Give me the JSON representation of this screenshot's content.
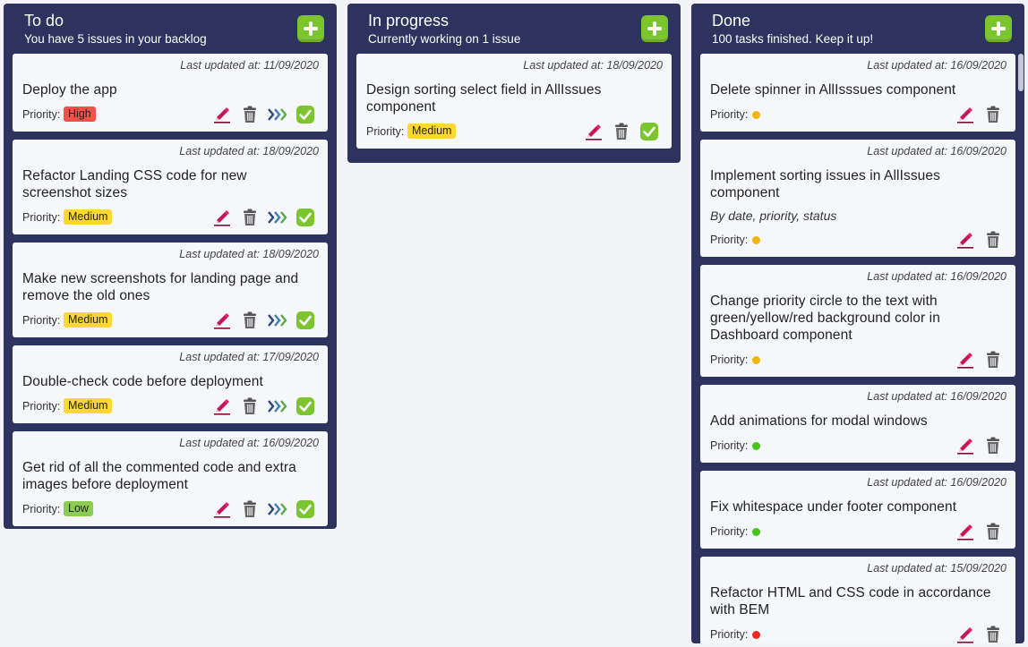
{
  "colors": {
    "column_bg": "#2b335e",
    "card_bg": "#f6f7fa",
    "add_button": "#7dc52e",
    "priority_high": "#ef5247",
    "priority_medium": "#fdd835",
    "priority_low": "#8ccc55",
    "dot_green": "#45c41a",
    "dot_yellow": "#f2b50f",
    "dot_red": "#f2271f"
  },
  "updated_prefix": "Last updated at: ",
  "priority_label": "Priority:",
  "columns": [
    {
      "title": "To do",
      "subtitle": "You have 5 issues in your backlog",
      "cards": [
        {
          "updated": "Last updated at: 11/09/2020",
          "title": "Deploy the app",
          "priority": "High"
        },
        {
          "updated": "Last updated at: 18/09/2020",
          "title": "Refactor Landing CSS code for new screenshot sizes",
          "priority": "Medium"
        },
        {
          "updated": "Last updated at: 18/09/2020",
          "title": "Make new screenshots for landing page and remove the old ones",
          "priority": "Medium"
        },
        {
          "updated": "Last updated at: 17/09/2020",
          "title": "Double-check code before deployment",
          "priority": "Medium"
        },
        {
          "updated": "Last updated at: 16/09/2020",
          "title": "Get rid of all the commented code and extra images before deployment",
          "priority": "Low"
        }
      ]
    },
    {
      "title": "In progress",
      "subtitle": "Currently working on 1 issue",
      "cards": [
        {
          "updated": "Last updated at: 18/09/2020",
          "title": "Design sorting select field in AllIssues component",
          "priority": "Medium"
        }
      ]
    },
    {
      "title": "Done",
      "subtitle": "100 tasks finished. Keep it up!",
      "cards": [
        {
          "updated": "Last updated at: 16/09/2020",
          "title": "Delete spinner in AllIsssues component",
          "priority_color": "yellow"
        },
        {
          "updated": "Last updated at: 16/09/2020",
          "title": "Implement sorting issues in AllIssues component",
          "description": "By date, priority, status",
          "priority_color": "yellow"
        },
        {
          "updated": "Last updated at: 16/09/2020",
          "title": "Change priority circle to the text with green/yellow/red background color in Dashboard component",
          "priority_color": "yellow"
        },
        {
          "updated": "Last updated at: 16/09/2020",
          "title": "Add animations for modal windows",
          "priority_color": "green"
        },
        {
          "updated": "Last updated at: 16/09/2020",
          "title": "Fix whitespace under footer component",
          "priority_color": "green"
        },
        {
          "updated": "Last updated at: 15/09/2020",
          "title": "Refactor HTML and CSS code in accordance with BEM",
          "priority_color": "red"
        }
      ]
    }
  ]
}
